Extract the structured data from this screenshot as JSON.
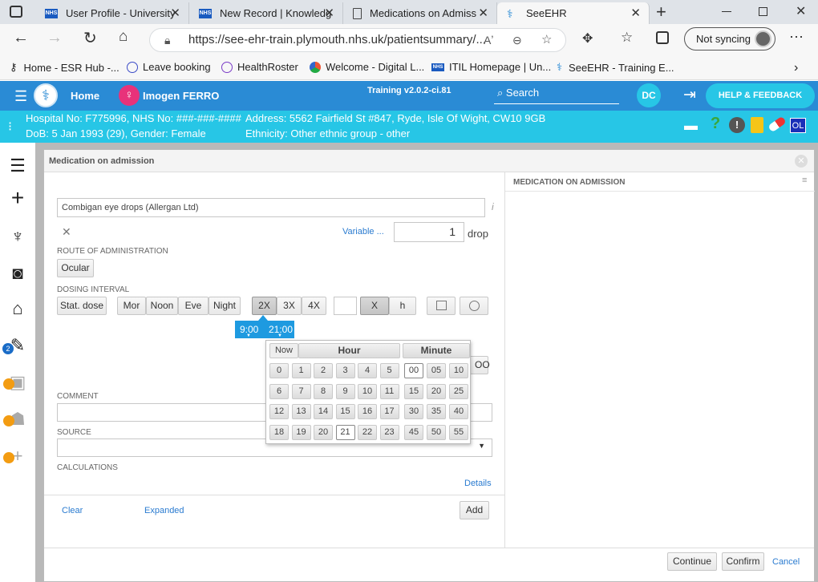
{
  "browser": {
    "tabs": [
      {
        "title": "User Profile - University",
        "icon": "nhs-icon"
      },
      {
        "title": "New Record | Knowledg",
        "icon": "nhs-icon"
      },
      {
        "title": "Medications on Admiss",
        "icon": "document-icon"
      },
      {
        "title": "SeeEHR",
        "icon": "seeehr-icon"
      }
    ],
    "url": "https://see-ehr-train.plymouth.nhs.uk/patientsummary/...",
    "profile_label": "Not syncing",
    "bookmarks": [
      "Home - ESR Hub -...",
      "Leave booking",
      "HealthRoster",
      "Welcome - Digital L...",
      "ITIL Homepage | Un...",
      "SeeEHR - Training E..."
    ],
    "nhs_badge": "NHS"
  },
  "app": {
    "home_label": "Home",
    "patient_name": "Imogen FERRO",
    "version": "Training v2.0.2-ci.81",
    "search_label": "Search",
    "user_initials": "DC",
    "help_label": "HELP & FEEDBACK",
    "patient": {
      "hospital_line": "Hospital No: F775996, NHS No: ###-###-####",
      "dob_line": "DoB: 5 Jan 1993 (29), Gender: Female",
      "address_line": "Address: 5562 Fairfield St #847, Ryde, Isle Of Wight, CW10 9GB",
      "ethnicity_line": "Ethnicity: Other ethnic group - other",
      "badge": "OL"
    },
    "sidebar_badge": "2"
  },
  "dialog": {
    "title": "Medication on admission",
    "right_panel_title": "MEDICATION ON ADMISSION",
    "drug": "Combigan eye drops (Allergan Ltd)",
    "variable_link": "Variable ...",
    "dose_value": "1",
    "dose_unit": "drop",
    "route_label": "ROUTE OF ADMINISTRATION",
    "route_value": "Ocular",
    "dosing_label": "DOSING INTERVAL",
    "stat_dose": "Stat. dose",
    "times": [
      "Mor",
      "Noon",
      "Eve",
      "Night"
    ],
    "freq": [
      "2X",
      "3X",
      "4X"
    ],
    "x_label": "X",
    "h_label": "h",
    "chips": [
      "9:00",
      "21:00"
    ],
    "hidden_btn_label": "OO",
    "comment_label": "COMMENT",
    "source_label": "SOURCE",
    "calculations_label": "CALCULATIONS",
    "details_link": "Details",
    "clear_link": "Clear",
    "expanded_link": "Expanded",
    "add_button": "Add",
    "continue_button": "Continue",
    "confirm_button": "Confirm",
    "cancel_link": "Cancel"
  },
  "timepicker": {
    "now_label": "Now",
    "hour_label": "Hour",
    "minute_label": "Minute",
    "hours": [
      "0",
      "1",
      "2",
      "3",
      "4",
      "5",
      "6",
      "7",
      "8",
      "9",
      "10",
      "11",
      "12",
      "13",
      "14",
      "15",
      "16",
      "17",
      "18",
      "19",
      "20",
      "21",
      "22",
      "23"
    ],
    "minutes": [
      "00",
      "05",
      "10",
      "15",
      "20",
      "25",
      "30",
      "35",
      "40",
      "45",
      "50",
      "55"
    ],
    "selected_hour": "21",
    "selected_minute": "00"
  },
  "colors": {
    "nav_blue": "#2a8bd5",
    "patient_cyan": "#27c6e6",
    "chip_blue": "#1e9ae0"
  }
}
